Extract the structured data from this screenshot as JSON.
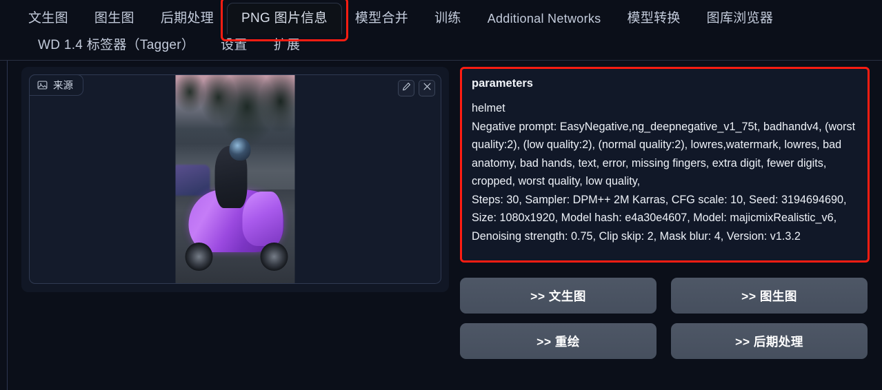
{
  "tabs": {
    "row1": [
      {
        "label": "文生图",
        "active": false
      },
      {
        "label": "图生图",
        "active": false
      },
      {
        "label": "后期处理",
        "active": false
      },
      {
        "label": "PNG 图片信息",
        "active": true
      },
      {
        "label": "模型合并",
        "active": false
      },
      {
        "label": "训练",
        "active": false
      },
      {
        "label": "Additional Networks",
        "active": false
      },
      {
        "label": "模型转换",
        "active": false
      },
      {
        "label": "图库浏览器",
        "active": false
      }
    ],
    "row2": [
      {
        "label": "WD 1.4 标签器（Tagger）",
        "active": false
      },
      {
        "label": "设置",
        "active": false
      },
      {
        "label": "扩展",
        "active": false
      }
    ]
  },
  "image_panel": {
    "source_tab_label": "来源",
    "source_icon": "image-icon",
    "edit_icon": "pencil-icon",
    "close_icon": "close-icon"
  },
  "parameters": {
    "title": "parameters",
    "body": "helmet\nNegative prompt: EasyNegative,ng_deepnegative_v1_75t, badhandv4, (worst quality:2), (low quality:2), (normal quality:2), lowres,watermark, lowres, bad anatomy, bad hands, text, error, missing fingers, extra digit, fewer digits, cropped, worst quality, low quality,\nSteps: 30, Sampler: DPM++ 2M Karras, CFG scale: 10, Seed: 3194694690, Size: 1080x1920, Model hash: e4a30e4607, Model: majicmixRealistic_v6, Denoising strength: 0.75, Clip skip: 2, Mask blur: 4, Version: v1.3.2",
    "highlight_color": "#ff1d12"
  },
  "actions": [
    {
      "label": ">> 文生图"
    },
    {
      "label": ">> 图生图"
    },
    {
      "label": ">> 重绘"
    },
    {
      "label": ">> 后期处理"
    }
  ],
  "colors": {
    "page_bg": "#0b0f19",
    "panel_bg": "#111725",
    "button_bg": "#4a5364",
    "accent_red": "#ff1d12",
    "text": "#eef2f8"
  }
}
